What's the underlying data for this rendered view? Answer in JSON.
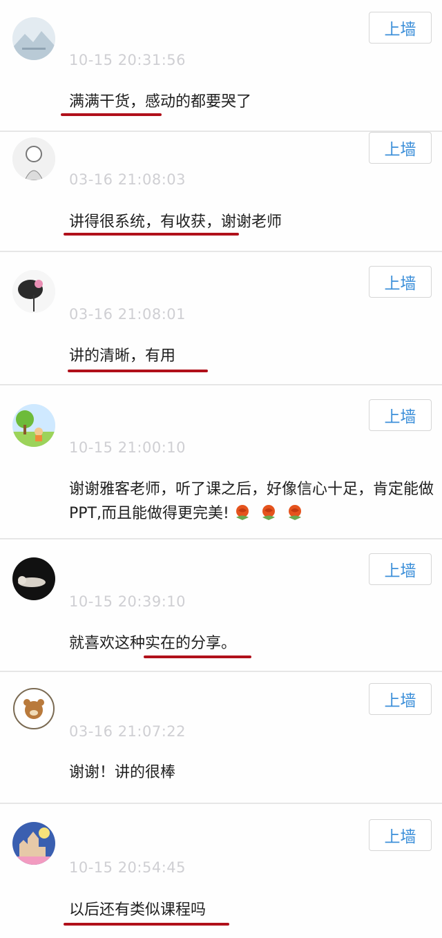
{
  "wall_button_label": "上墙",
  "comments": [
    {
      "time": "10-15 20:31:56",
      "text": "满满干货，感动的都要哭了",
      "avatar": "landscape-avatar"
    },
    {
      "time": "03-16 21:08:03",
      "text": "讲得很系统，有收获，谢谢老师",
      "avatar": "sketch-girl-avatar"
    },
    {
      "time": "03-16 21:08:01",
      "text": "讲的清晰，有用",
      "avatar": "ink-lotus-avatar"
    },
    {
      "time": "10-15 21:00:10",
      "text": "谢谢雅客老师，听了课之后，好像信心十足，肯定能做PPT,而且能做得更完美!",
      "emoji": "rose-emoji",
      "emoji_count": 3,
      "avatar": "cartoon-tree-avatar"
    },
    {
      "time": "10-15 20:39:10",
      "text": "就喜欢这种实在的分享。",
      "avatar": "dark-portrait-avatar"
    },
    {
      "time": "03-16 21:07:22",
      "text": "谢谢！讲的很棒",
      "avatar": "bear-badge-avatar"
    },
    {
      "time": "10-15 20:54:45",
      "text": "以后还有类似课程吗",
      "avatar": "castle-avatar"
    }
  ],
  "colors": {
    "accent": "#3c8fd9",
    "underline": "#b0101a",
    "timestamp": "#cfcfd3"
  }
}
